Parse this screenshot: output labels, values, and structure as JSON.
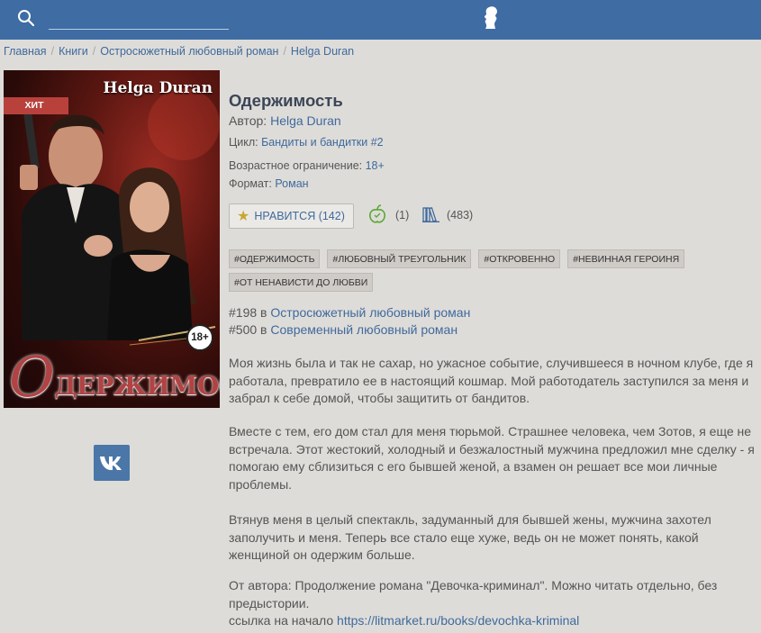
{
  "topbar": {
    "search_placeholder": "",
    "search_icon": "search-icon",
    "logo_icon": "pushkin-profile-icon",
    "color": "#3e6ca3"
  },
  "breadcrumb": [
    "Главная",
    "Книги",
    "Остросюжетный любовный роман",
    "Helga Duran"
  ],
  "cover": {
    "author": "Helga Duran",
    "title_first_letter": "О",
    "title_rest": "ДЕРЖИМОСТЬ",
    "hit_label": "ХИТ",
    "age_label": "18+"
  },
  "social": {
    "vk_icon": "vk-icon"
  },
  "book": {
    "title": "Одержимость",
    "author_label": "Автор:",
    "author": "Helga Duran",
    "cycle_label": "Цикл:",
    "cycle": "Бандиты и бандитки #2",
    "age_label": "Возрастное ограничение:",
    "age": "18+",
    "format_label": "Формат:",
    "format": "Роман"
  },
  "stats": {
    "like_label": "НРАВИТСЯ (142)",
    "rewards": "(1)",
    "libraries": "(483)"
  },
  "tags": [
    "#ОДЕРЖИМОСТЬ",
    "#ЛЮБОВНЫЙ ТРЕУГОЛЬНИК",
    "#ОТКРОВЕННО",
    "#НЕВИННАЯ ГЕРОИНЯ",
    "#ОТ НЕНАВИСТИ ДО ЛЮБВИ"
  ],
  "ranks": [
    {
      "position": "#198 в",
      "category": "Остросюжетный любовный роман"
    },
    {
      "position": "#500 в",
      "category": "Современный любовный роман"
    }
  ],
  "description": {
    "p1": "Моя жизнь была и так не сахар, но ужасное событие, случившееся в ночном клубе, где я работала, превратило ее в настоящий кошмар. Мой работодатель заступился за меня и забрал к себе домой, чтобы защитить от бандитов.",
    "p2": "Вместе с тем, его дом стал для меня тюрьмой. Страшнее человека, чем Зотов, я еще не встречала. Этот жестокий, холодный и безжалостный мужчина предложил мне сделку - я помогаю ему сблизиться с его бывшей женой, а взамен он решает все мои личные проблемы.",
    "p3": "Втянув меня в целый спектакль, задуманный для бывшей жены, мужчина захотел заполучить и меня. Теперь все стало еще хуже, ведь он не может понять, какой женщиной он одержим больше.",
    "p4": "От автора: Продолжение романа \"Девочка-криминал\". Можно читать отдельно, без предыстории.",
    "link_prefix": "ссылка на начало",
    "link": "https://litmarket.ru/books/devochka-kriminal"
  }
}
